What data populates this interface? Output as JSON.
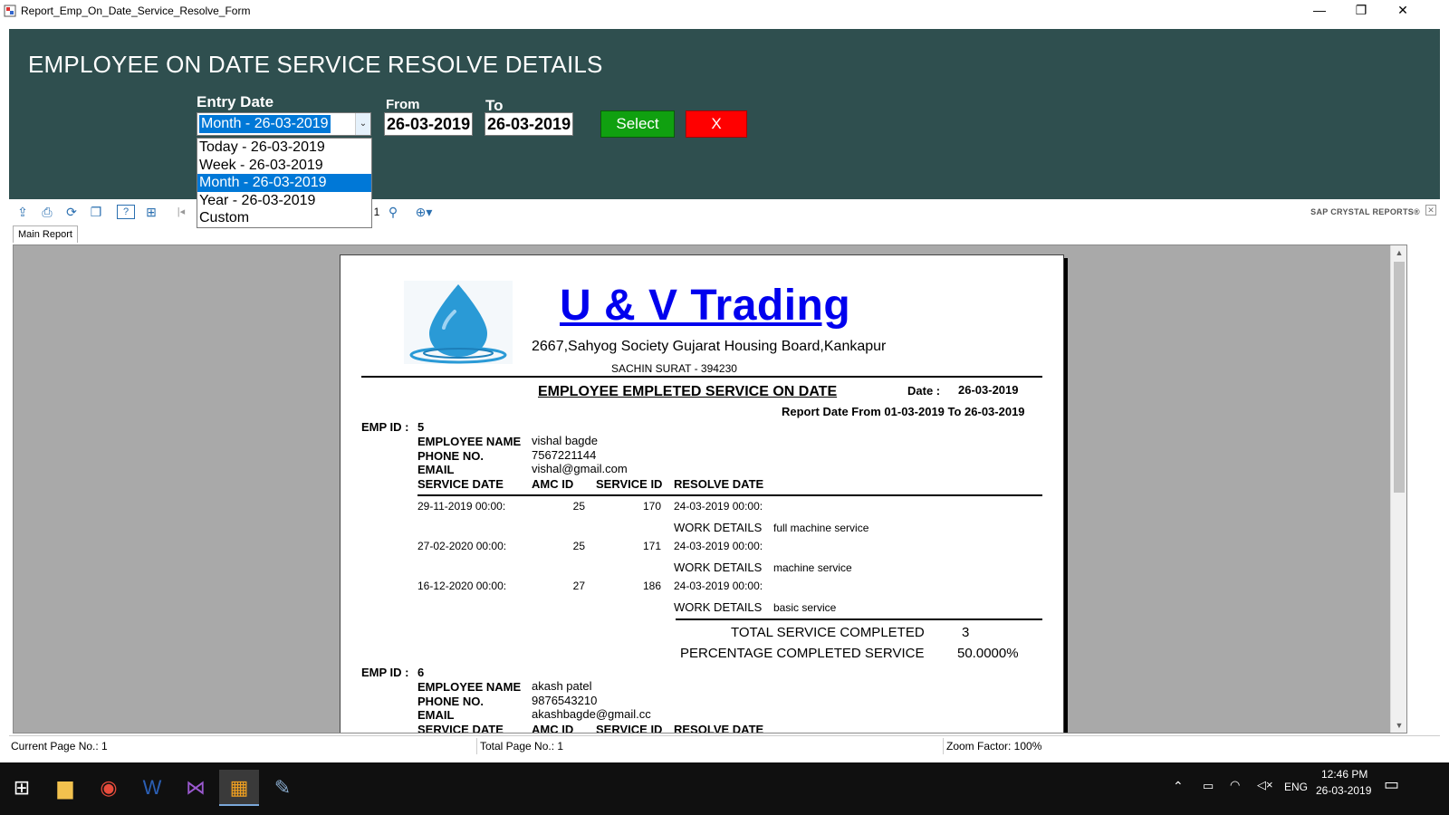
{
  "window": {
    "title": "Report_Emp_On_Date_Service_Resolve_Form",
    "minimize": "—",
    "restore": "❐",
    "close": "✕"
  },
  "header": {
    "heading": "EMPLOYEE ON DATE SERVICE RESOLVE DETAILS",
    "entry_date_label": "Entry Date",
    "from_label": "From",
    "to_label": "To",
    "entry_date_value": "Month - 26-03-2019",
    "from_value": "26-03-2019",
    "to_value": "26-03-2019",
    "select_label": "Select",
    "close_label": "X",
    "colors": {
      "panel": "#2f4f4f",
      "select": "#10a010",
      "close": "#ff0000"
    }
  },
  "dropdown": {
    "options": [
      "Today - 26-03-2019",
      "Week - 26-03-2019",
      "Month - 26-03-2019",
      "Year - 26-03-2019",
      "Custom"
    ],
    "selected_index": 2
  },
  "toolbar": {
    "page_number": "1",
    "brand": "SAP CRYSTAL REPORTS®",
    "icons": [
      "export-icon",
      "print-icon",
      "refresh-icon",
      "copy-icon",
      "help-icon",
      "group-tree-icon",
      "first-page-icon",
      "find-icon",
      "zoom-icon"
    ]
  },
  "tabs": {
    "main": "Main Report"
  },
  "report": {
    "company": "U & V Trading",
    "address_line1": "2667,Sahyog Society Gujarat Housing Board,Kankapur",
    "address_line2": "SACHIN SURAT - 394230",
    "title": "EMPLOYEE EMPLETED SERVICE ON DATE",
    "date_label": "Date :",
    "date_value": "26-03-2019",
    "range": "Report Date From 01-03-2019 To 26-03-2019",
    "labels": {
      "emp_id": "EMP ID :",
      "employee_name": "EMPLOYEE NAME",
      "phone": "PHONE NO.",
      "email": "EMAIL",
      "service_date": "SERVICE DATE",
      "amc_id": "AMC ID",
      "service_id": "SERVICE ID",
      "resolve_date": "RESOLVE DATE",
      "work_details": "WORK DETAILS",
      "total": "TOTAL SERVICE COMPLETED",
      "percentage": "PERCENTAGE  COMPLETED SERVICE"
    },
    "employees": [
      {
        "id": "5",
        "name": "vishal bagde",
        "phone": "7567221144",
        "email": "vishal@gmail.com",
        "rows": [
          {
            "service_date": "29-11-2019  00:00:",
            "amc_id": "25",
            "service_id": "170",
            "resolve_date": "24-03-2019  00:00:",
            "work": "full machine service"
          },
          {
            "service_date": "27-02-2020  00:00:",
            "amc_id": "25",
            "service_id": "171",
            "resolve_date": "24-03-2019  00:00:",
            "work": "machine service"
          },
          {
            "service_date": "16-12-2020  00:00:",
            "amc_id": "27",
            "service_id": "186",
            "resolve_date": "24-03-2019  00:00:",
            "work": "basic service"
          }
        ],
        "total": "3",
        "percentage": "50.0000%"
      },
      {
        "id": "6",
        "name": "akash patel",
        "phone": "9876543210",
        "email": "akashbagde@gmail.cc"
      }
    ]
  },
  "status": {
    "current_page": "Current Page No.: 1",
    "total_page": "Total Page No.: 1",
    "zoom": "Zoom Factor: 100%"
  },
  "taskbar": {
    "apps": [
      "windows-start-icon",
      "file-explorer-icon",
      "chrome-icon",
      "word-icon",
      "visual-studio-icon",
      "crystal-app-icon",
      "paint-icon"
    ],
    "language": "ENG",
    "time": "12:46 PM",
    "date": "26-03-2019"
  }
}
